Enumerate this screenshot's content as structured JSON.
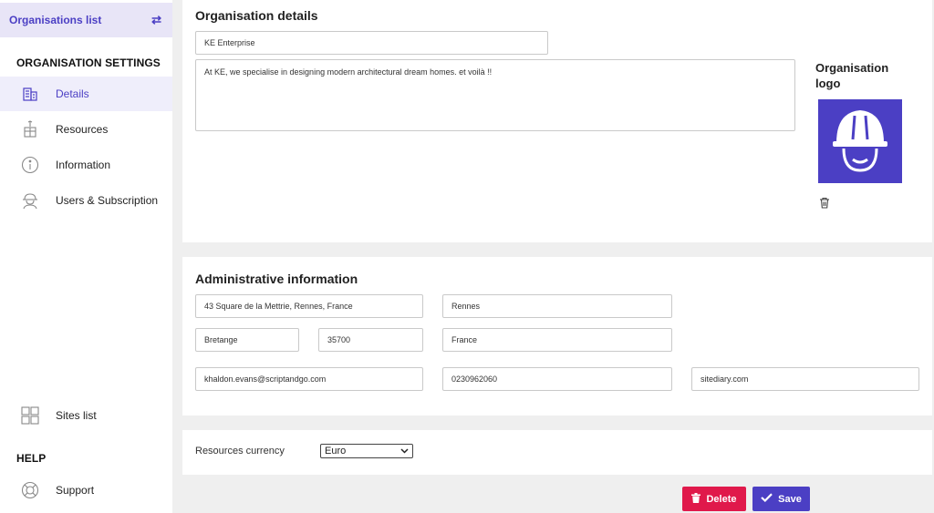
{
  "sidebar": {
    "org_list_label": "Organisations list",
    "settings_heading": "ORGANISATION SETTINGS",
    "items": [
      {
        "label": "Details"
      },
      {
        "label": "Resources"
      },
      {
        "label": "Information"
      },
      {
        "label": "Users & Subscription"
      }
    ],
    "sites_list": "Sites list",
    "help_heading": "HELP",
    "support": "Support"
  },
  "details": {
    "title": "Organisation details",
    "name_value": "KE Enterprise",
    "description_value": "At KE, we specialise in designing modern architectural dream homes. et voilà !!",
    "logo_title": "Organisation logo"
  },
  "admin": {
    "title": "Administrative information",
    "address": "43 Square de la Mettrie, Rennes, France",
    "city": "Rennes",
    "region": "Bretange",
    "postal_code": "35700",
    "country": "France",
    "email": "khaldon.evans@scriptandgo.com",
    "phone": "0230962060",
    "website": "sitediary.com"
  },
  "currency": {
    "label": "Resources currency",
    "selected": "Euro"
  },
  "actions": {
    "delete_label": "Delete",
    "save_label": "Save"
  },
  "colors": {
    "accent": "#4b3fc4",
    "danger": "#e0194b"
  }
}
